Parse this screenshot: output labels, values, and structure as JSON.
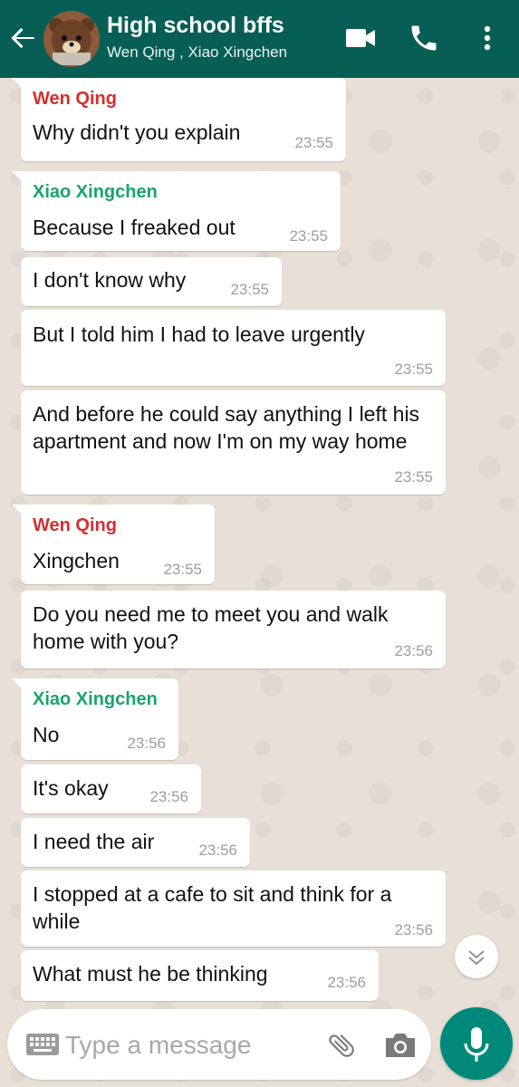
{
  "header": {
    "title": "High school bffs",
    "subtitle": "Wen Qing , Xiao Xingchen"
  },
  "colors": {
    "header_bg": "#075e54",
    "wen_qing": "#d32f2f",
    "xiao_xingchen": "#1aa36b",
    "mic_button": "#00897b"
  },
  "messages": [
    {
      "sender": "Wen Qing",
      "text": "Why didn't you explain",
      "time": "23:55"
    },
    {
      "sender": "Xiao Xingchen",
      "text": "Because I freaked out",
      "time": "23:55"
    },
    {
      "text": "I don't know why",
      "time": "23:55"
    },
    {
      "text": "But I told him I had to leave urgently",
      "time": "23:55"
    },
    {
      "text": "And before he could say anything I left his apartment and now I'm on my way home",
      "time": "23:55"
    },
    {
      "sender": "Wen Qing",
      "text": "Xingchen",
      "time": "23:55"
    },
    {
      "text": "Do you need me to meet you and walk home with you?",
      "time": "23:56"
    },
    {
      "sender": "Xiao Xingchen",
      "text": "No",
      "time": "23:56"
    },
    {
      "text": "It's okay",
      "time": "23:56"
    },
    {
      "text": "I need the air",
      "time": "23:56"
    },
    {
      "text": "I stopped at a cafe to sit and think for a while",
      "time": "23:56"
    },
    {
      "text": "What must he be thinking",
      "time": "23:56"
    }
  ],
  "input": {
    "placeholder": "Type a message"
  },
  "icons": {
    "back": "arrow-left-icon",
    "video": "video-camera-icon",
    "call": "phone-icon",
    "more": "more-vertical-icon",
    "keyboard": "keyboard-icon",
    "attach": "paperclip-icon",
    "camera": "camera-icon",
    "mic": "microphone-icon",
    "scroll": "chevron-double-down-icon"
  }
}
